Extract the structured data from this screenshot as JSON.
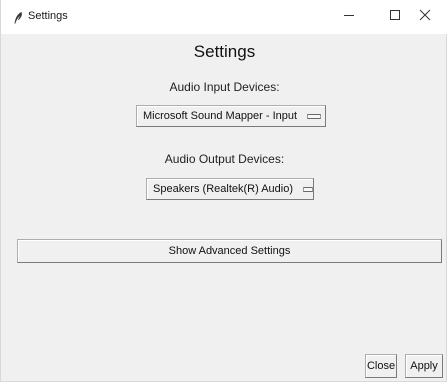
{
  "window": {
    "title": "Settings",
    "icon": "feather-icon",
    "controls": {
      "minimize_icon": "minimize-icon",
      "maximize_icon": "maximize-icon",
      "close_icon": "close-icon"
    }
  },
  "main": {
    "heading": "Settings",
    "input": {
      "label": "Audio Input Devices:",
      "selected": "Microsoft Sound Mapper - Input"
    },
    "output": {
      "label": "Audio Output Devices:",
      "selected": "Speakers (Realtek(R) Audio)"
    },
    "advanced_button": "Show Advanced Settings"
  },
  "footer": {
    "close_label": "Close",
    "apply_label": "Apply"
  },
  "colors": {
    "background": "#f0f0f0",
    "titlebar": "#ffffff",
    "border": "#adadad"
  }
}
